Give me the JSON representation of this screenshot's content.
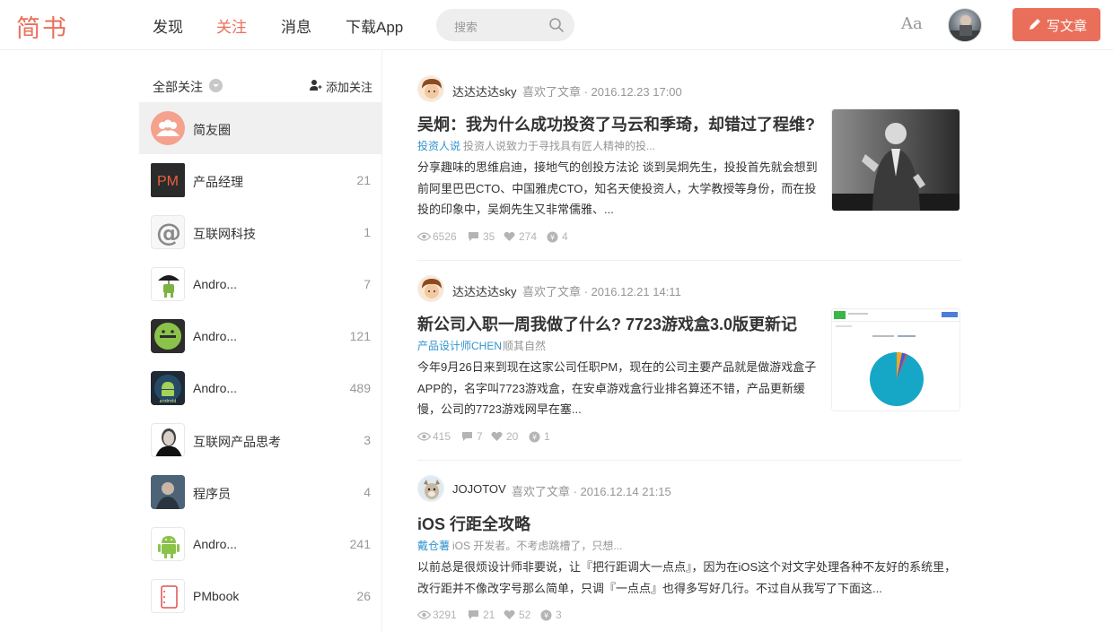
{
  "brand": {
    "logo": "简书",
    "accent": "#ea6f5a",
    "link": "#3194d0"
  },
  "nav": {
    "items": [
      {
        "label": "发现",
        "active": false
      },
      {
        "label": "关注",
        "active": true
      },
      {
        "label": "消息",
        "active": false
      },
      {
        "label": "下载App",
        "active": false
      }
    ],
    "search_placeholder": "搜索",
    "font_toggle": "Aa",
    "write_label": "写文章"
  },
  "sidebar": {
    "title": "全部关注",
    "add_label": "添加关注",
    "items": [
      {
        "label": "简友圈",
        "count": "",
        "icon": "friends-group-icon",
        "active": true
      },
      {
        "label": "产品经理",
        "count": "21",
        "icon": "pm-logo"
      },
      {
        "label": "互联网科技",
        "count": "1",
        "icon": "at-sign-logo"
      },
      {
        "label": "Andro...",
        "count": "7",
        "icon": "android-umbrella-logo"
      },
      {
        "label": "Andro...",
        "count": "121",
        "icon": "android-robot-logo"
      },
      {
        "label": "Andro...",
        "count": "489",
        "icon": "android-badge-logo"
      },
      {
        "label": "互联网产品思考",
        "count": "3",
        "icon": "portrait-photo"
      },
      {
        "label": "程序员",
        "count": "4",
        "icon": "programmer-photo"
      },
      {
        "label": "Andro...",
        "count": "241",
        "icon": "android-green-logo"
      },
      {
        "label": "PMbook",
        "count": "26",
        "icon": "notebook-logo"
      }
    ]
  },
  "feed": [
    {
      "author": "达达达达sky",
      "meta": "喜欢了文章 · 2016.12.23 17:00",
      "title": "吴炯：我为什么成功投资了马云和季琦，却错过了程维?",
      "collection": "投资人说",
      "collection_desc": "投资人说致力于寻找具有匠人精神的投...",
      "abstract": "分享趣味的思维启迪，接地气的创投方法论 谈到吴炯先生，投投首先就会想到前阿里巴巴CTO、中国雅虎CTO，知名天使投资人，大学教授等身份，而在投投的印象中，吴炯先生又非常儒雅、...",
      "views": "6526",
      "comments": "35",
      "likes": "274",
      "rewards": "4",
      "cover": "speaker-photo"
    },
    {
      "author": "达达达达sky",
      "meta": "喜欢了文章 · 2016.12.21 14:11",
      "title": "新公司入职一周我做了什么? 7723游戏盒3.0版更新记",
      "collection": "产品设计师CHEN",
      "collection_desc": "顺其自然",
      "abstract": "今年9月26日来到现在这家公司任职PM，现在的公司主要产品就是做游戏盒子APP的，名字叫7723游戏盒，在安卓游戏盒行业排名算还不错，产品更新缓慢，公司的7723游戏网早在塞...",
      "views": "415",
      "comments": "7",
      "likes": "20",
      "rewards": "1",
      "cover": "pie-chart-screenshot"
    },
    {
      "author": "JOJOTOV",
      "meta": "喜欢了文章 · 2016.12.14 21:15",
      "title": "iOS 行距全攻略",
      "collection": "戴仓薯",
      "collection_desc": "iOS 开发者。不考虑跳槽了，只想...",
      "abstract": "以前总是很烦设计师非要说，让『把行距调大一点点』，因为在iOS这个对文字处理各种不友好的系统里，改行距并不像改字号那么简单，只调『一点点』也得多写好几行。不过自从我写了下面这...",
      "views": "3291",
      "comments": "21",
      "likes": "52",
      "rewards": "3",
      "cover": ""
    }
  ]
}
